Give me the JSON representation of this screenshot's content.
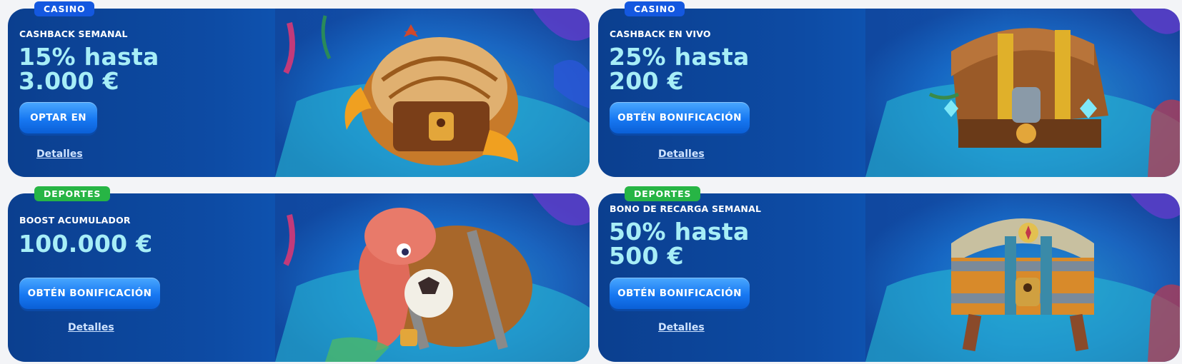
{
  "promos": [
    {
      "category": "CASINO",
      "title": "CASHBACK SEMANAL",
      "amount_line1": "15% hasta",
      "amount_line2": "3.000 €",
      "button_label": "OPTAR EN",
      "details_label": "Detalles",
      "art_icon": "hermit-crab-chest-icon"
    },
    {
      "category": "CASINO",
      "title": "CASHBACK EN VIVO",
      "amount_line1": "25% hasta",
      "amount_line2": "200 €",
      "button_label": "OBTÉN BONIFICACIÓN",
      "details_label": "Detalles",
      "art_icon": "wooden-treasure-chest-icon"
    },
    {
      "category": "DEPORTES",
      "title": "BOOST ACUMULADOR",
      "amount_line1": "100.000 €",
      "button_label": "OBTÉN BONIFICACIÓN",
      "details_label": "Detalles",
      "art_icon": "octopus-barrel-icon"
    },
    {
      "category": "DEPORTES",
      "title": "BONO DE RECARGA SEMANAL",
      "amount_line1": "50% hasta",
      "amount_line2": "500 €",
      "button_label": "OBTÉN BONIFICACIÓN",
      "details_label": "Detalles",
      "art_icon": "compass-treasure-chest-icon"
    }
  ],
  "colors": {
    "casino_badge": "#1458e0",
    "sports_badge": "#27b545",
    "amount_text": "#a7eef7",
    "card_bg": "#0d4ba4",
    "button": "#1778f2"
  }
}
